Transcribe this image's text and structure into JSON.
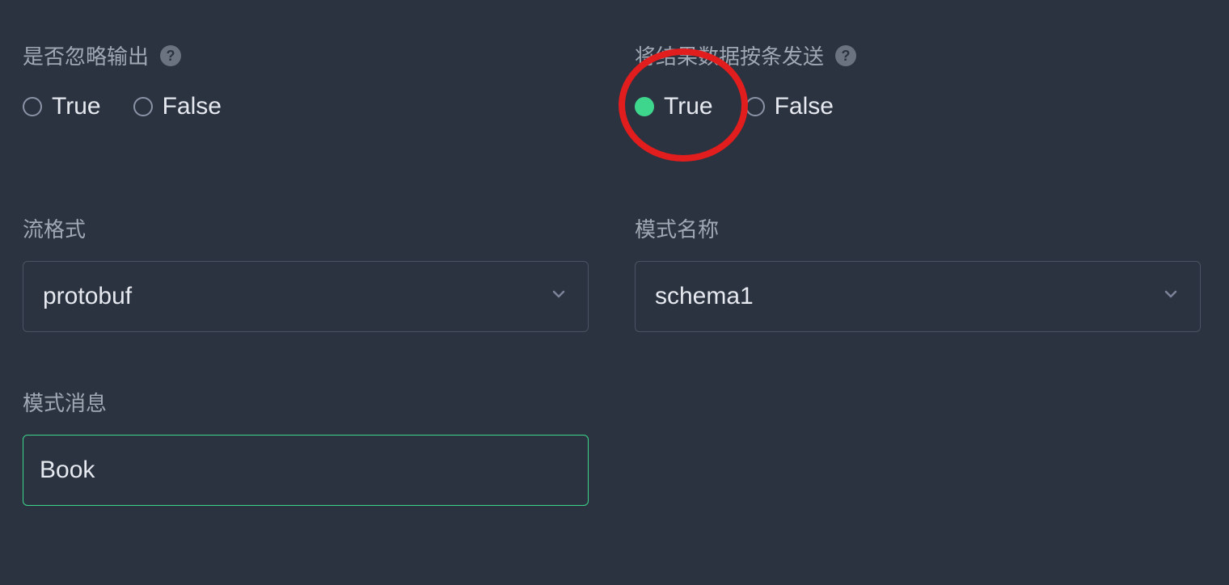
{
  "fields": {
    "ignoreOutput": {
      "label": "是否忽略输出",
      "hasHelp": true,
      "options": {
        "true": "True",
        "false": "False"
      },
      "selected": null
    },
    "sendRowByRow": {
      "label": "将结果数据按条发送",
      "hasHelp": true,
      "options": {
        "true": "True",
        "false": "False"
      },
      "selected": "true",
      "highlighted": true
    },
    "streamFormat": {
      "label": "流格式",
      "value": "protobuf"
    },
    "schemaName": {
      "label": "模式名称",
      "value": "schema1"
    },
    "schemaMessage": {
      "label": "模式消息",
      "value": "Book"
    }
  },
  "icons": {
    "help": "?"
  }
}
